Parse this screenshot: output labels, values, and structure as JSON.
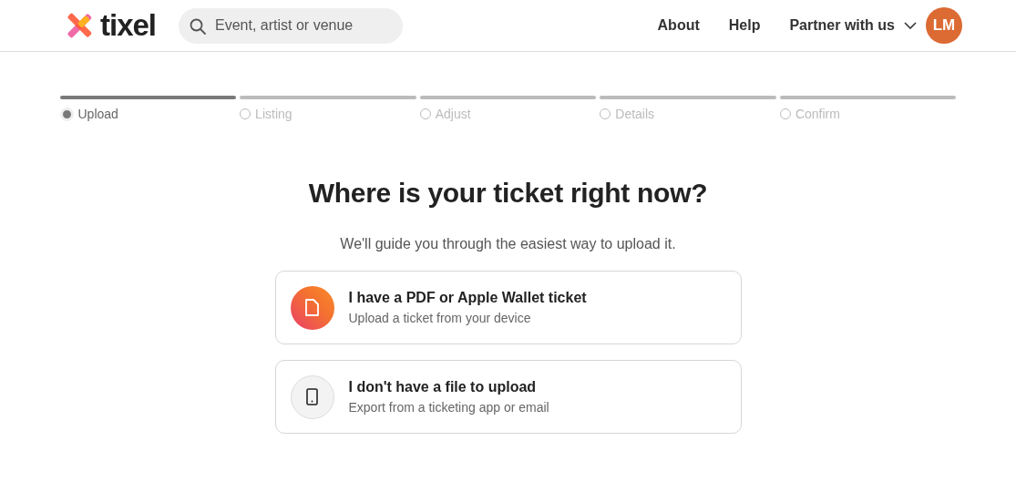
{
  "header": {
    "logo": "tixel",
    "search": {
      "placeholder": "Event, artist or venue"
    },
    "nav": [
      "About",
      "Help"
    ],
    "menu": "Partner with us",
    "avatar": "LM"
  },
  "steps": [
    {
      "label": "Upload",
      "selected": true
    },
    {
      "label": "Listing",
      "selected": false
    },
    {
      "label": "Adjust",
      "selected": false
    },
    {
      "label": "Details",
      "selected": false
    },
    {
      "label": "Confirm",
      "selected": false
    }
  ],
  "title": "Where is your ticket right now?",
  "subtitle": "We'll guide you through the easiest way to upload it.",
  "options": [
    {
      "kind": "file",
      "title": "I have a PDF or Apple Wallet ticket",
      "description": "Upload a ticket from your device"
    },
    {
      "kind": "phone",
      "title": "I don't have a file to upload",
      "description": "Export from a ticketing app or email"
    }
  ]
}
